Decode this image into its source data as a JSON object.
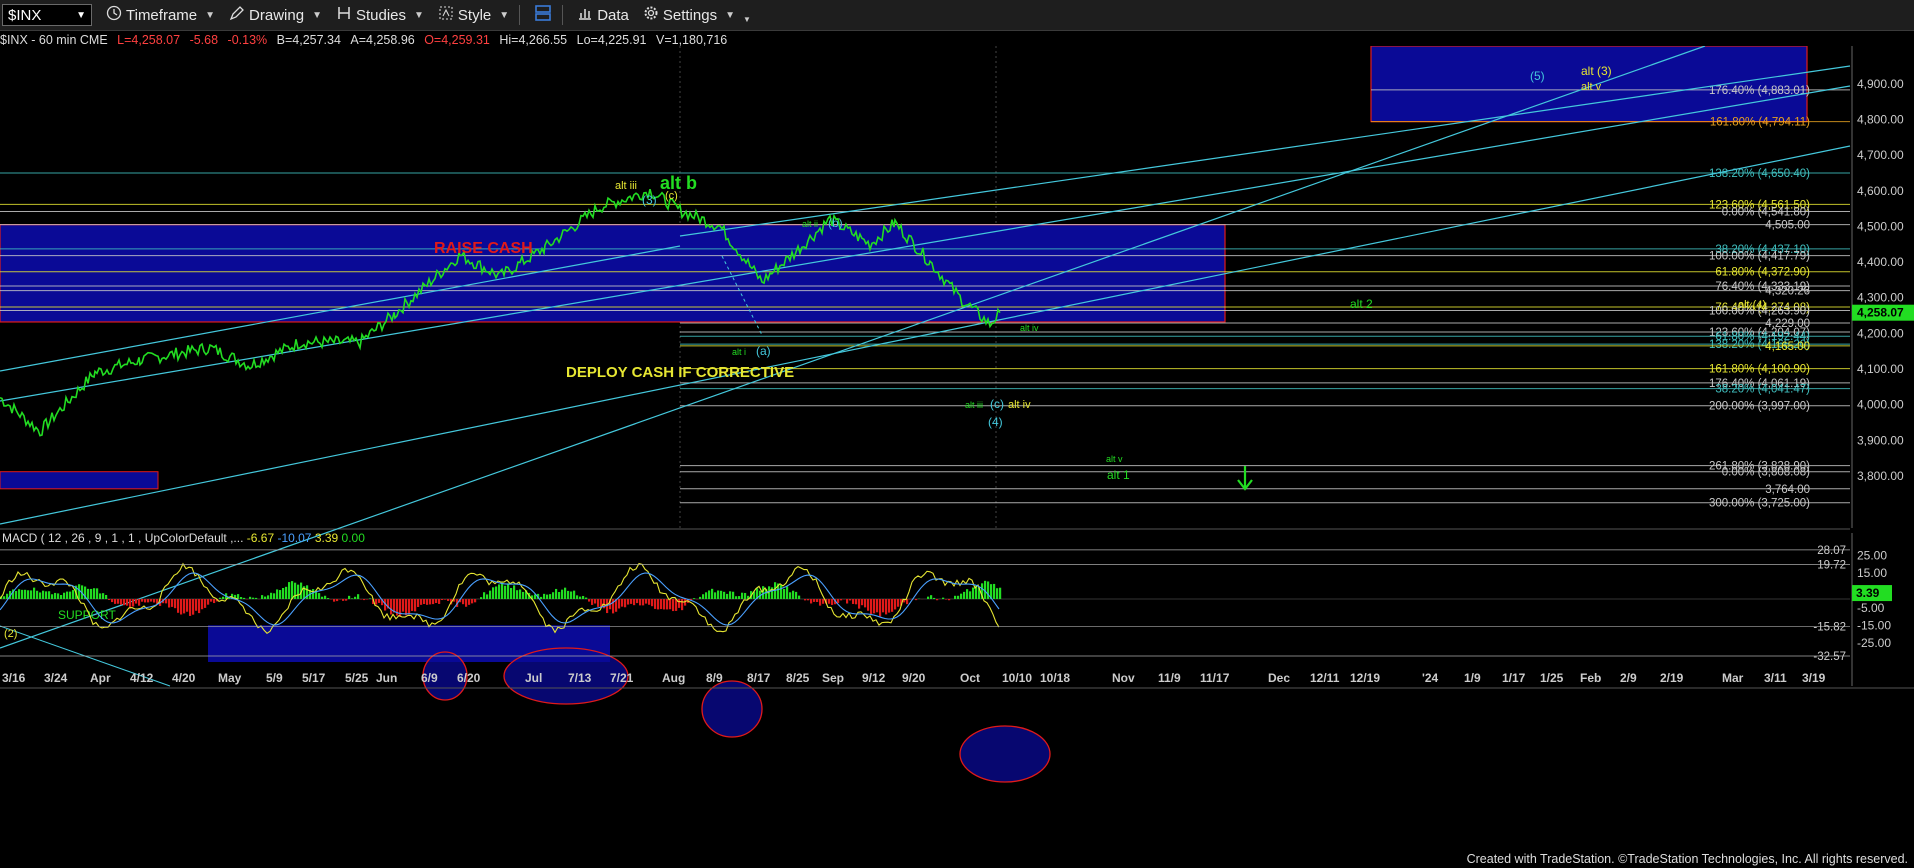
{
  "toolbar": {
    "symbol": "$INX",
    "items": [
      {
        "label": "Timeframe",
        "icon": "clock-icon"
      },
      {
        "label": "Drawing",
        "icon": "pencil-icon"
      },
      {
        "label": "Studies",
        "icon": "studies-icon"
      },
      {
        "label": "Style",
        "icon": "style-icon"
      },
      {
        "label": "",
        "icon": "layout-icon"
      },
      {
        "label": "Data",
        "icon": "bar-chart-icon"
      },
      {
        "label": "Settings",
        "icon": "gear-icon"
      }
    ]
  },
  "info_line": {
    "symbol": "$INX - 60 min CME",
    "last": "L=4,258.07",
    "chg": "-5.68",
    "pct": "-0.13%",
    "bid": "B=4,257.34",
    "ask": "A=4,258.96",
    "open": "O=4,259.31",
    "high": "Hi=4,266.55",
    "low": "Lo=4,225.91",
    "volume": "V=1,180,716"
  },
  "macd_header": {
    "name": "MACD ( 12 , 26 , 9 , 1 , 1 , UpColorDefault ,...",
    "v1": "-6.67",
    "v2": "-10.07",
    "v3": "3.39",
    "v4": "0.00"
  },
  "colors": {
    "price": "#22dd22",
    "channel": "#44c8dc",
    "blue_box": "#0a0a96",
    "fib": "#c8c8c8",
    "yellow": "#e6e632",
    "red": "#e01a1a"
  },
  "price_axis": {
    "ticks": [
      {
        "label": "4,900.00",
        "v": 4900
      },
      {
        "label": "4,800.00",
        "v": 4800
      },
      {
        "label": "4,700.00",
        "v": 4700
      },
      {
        "label": "4,600.00",
        "v": 4600
      },
      {
        "label": "4,500.00",
        "v": 4500
      },
      {
        "label": "4,400.00",
        "v": 4400
      },
      {
        "label": "4,300.00",
        "v": 4300
      },
      {
        "label": "4,200.00",
        "v": 4200
      },
      {
        "label": "4,100.00",
        "v": 4100
      },
      {
        "label": "4,000.00",
        "v": 4000
      },
      {
        "label": "3,900.00",
        "v": 3900
      },
      {
        "label": "3,800.00",
        "v": 3800
      }
    ],
    "last_price": "4,258.07"
  },
  "levels": [
    {
      "label": "176.40% (4,883.01)",
      "v": 4883,
      "color": "#c8c8c8"
    },
    {
      "label": "161.80% (4,794.11)",
      "v": 4794,
      "color": "#e6a020"
    },
    {
      "label": "138.20% (4,650.40)",
      "v": 4650,
      "color": "#40c0c0"
    },
    {
      "label": "123.60% (4,561.50)",
      "v": 4562,
      "color": "#e6e632"
    },
    {
      "label": "0.00% (4,541.80)",
      "v": 4542,
      "color": "#c8c8c8"
    },
    {
      "label": "4,505.00",
      "v": 4505,
      "color": "#c8c8c8"
    },
    {
      "label": "38.20% (4,437.10)",
      "v": 4437,
      "color": "#40c0c0"
    },
    {
      "label": "100.00% (4,417.79)",
      "v": 4418,
      "color": "#c8c8c8"
    },
    {
      "label": "61.80% (4,372.90)",
      "v": 4373,
      "color": "#e6e632"
    },
    {
      "label": "76.40% (4,333.19)",
      "v": 4333,
      "color": "#c8c8c8"
    },
    {
      "label": "4,320.26",
      "v": 4320,
      "color": "#c8c8c8"
    },
    {
      "label": "76.40% (4,274.08)",
      "v": 4274,
      "color": "#e6e632"
    },
    {
      "label": "100.00% (4,263.90)",
      "v": 4264,
      "color": "#c8c8c8"
    },
    {
      "label": "4,229.00",
      "v": 4229,
      "color": "#c8c8c8"
    },
    {
      "label": "123.60% (4,204.07)",
      "v": 4204,
      "color": "#c8c8c8"
    },
    {
      "label": "61.80% (4,192.44)",
      "v": 4192,
      "color": "#40c0c0"
    },
    {
      "label": "138.20% (4,165.20)",
      "v": 4170,
      "color": "#40c0c0"
    },
    {
      "label": "4,165.00",
      "v": 4165,
      "color": "#e6e632"
    },
    {
      "label": "161.80% (4,100.90)",
      "v": 4101,
      "color": "#e6e632"
    },
    {
      "label": "176.40% (4,061.19)",
      "v": 4061,
      "color": "#c8c8c8"
    },
    {
      "label": "38.20% (4,041.47)",
      "v": 4045,
      "color": "#40c0c0"
    },
    {
      "label": "200.00% (3,997.00)",
      "v": 3997,
      "color": "#c8c8c8"
    },
    {
      "label": "261.80% (3,828.90)",
      "v": 3829,
      "color": "#c8c8c8"
    },
    {
      "label": "0.00% (3,808.08)",
      "v": 3812,
      "color": "#c8c8c8"
    },
    {
      "label": "3,764.00",
      "v": 3764,
      "color": "#c8c8c8"
    },
    {
      "label": "300.00% (3,725.00)",
      "v": 3725,
      "color": "#c8c8c8"
    }
  ],
  "annotations": [
    {
      "text": "RAISE CASH",
      "color": "#e01a1a",
      "size": 16,
      "bold": true
    },
    {
      "text": "DEPLOY CASH IF CORRECTIVE",
      "color": "#e6e632",
      "size": 15,
      "bold": true
    },
    {
      "text": "SUPPORT",
      "color": "#22dd22",
      "size": 12,
      "bold": false
    },
    {
      "text": "alt b",
      "color": "#22dd22",
      "size": 18,
      "bold": true
    },
    {
      "text": "alt iii",
      "color": "#e6e632",
      "size": 11,
      "bold": false
    },
    {
      "text": "(3)",
      "color": "#44c8dc",
      "size": 12,
      "bold": false
    },
    {
      "text": "(c)",
      "color": "#e6e632",
      "size": 11,
      "bold": false
    },
    {
      "text": "alt ii",
      "color": "#22dd22",
      "size": 9,
      "bold": false
    },
    {
      "text": "(b)",
      "color": "#44c8dc",
      "size": 12,
      "bold": false
    },
    {
      "text": "alt i",
      "color": "#22dd22",
      "size": 9,
      "bold": false
    },
    {
      "text": "(a)",
      "color": "#44c8dc",
      "size": 12,
      "bold": false
    },
    {
      "text": "alt iv",
      "color": "#22dd22",
      "size": 9,
      "bold": false
    },
    {
      "text": "alt iii",
      "color": "#22dd22",
      "size": 9,
      "bold": false
    },
    {
      "text": "(c)",
      "color": "#44c8dc",
      "size": 12,
      "bold": false
    },
    {
      "text": "alt iv",
      "color": "#e6e632",
      "size": 11,
      "bold": false
    },
    {
      "text": "(4)",
      "color": "#44c8dc",
      "size": 12,
      "bold": false
    },
    {
      "text": "alt 2",
      "color": "#22dd22",
      "size": 12,
      "bold": false
    },
    {
      "text": "alt (4)",
      "color": "#e6e632",
      "size": 11,
      "bold": false
    },
    {
      "text": "alt v",
      "color": "#22dd22",
      "size": 9,
      "bold": false
    },
    {
      "text": "alt 1",
      "color": "#22dd22",
      "size": 12,
      "bold": false
    },
    {
      "text": "(5)",
      "color": "#44c8dc",
      "size": 12,
      "bold": false
    },
    {
      "text": "alt (3)",
      "color": "#e6e632",
      "size": 12,
      "bold": false
    },
    {
      "text": "alt v",
      "color": "#e6e632",
      "size": 11,
      "bold": false
    },
    {
      "text": "(2)",
      "color": "#e6e632",
      "size": 11,
      "bold": false
    }
  ],
  "macd_axis": {
    "ticks": [
      {
        "label": "25.00",
        "v": 25
      },
      {
        "label": "15.00",
        "v": 15
      },
      {
        "label": "-5.00",
        "v": -5
      },
      {
        "label": "-15.00",
        "v": -15
      },
      {
        "label": "-25.00",
        "v": -25
      }
    ],
    "levels": [
      {
        "label": "19.72",
        "v": 19.72
      },
      {
        "label": "-15.82",
        "v": -15.82
      },
      {
        "label": "-32.57",
        "v": -32.57
      },
      {
        "label": "28.07",
        "v": 28.07
      }
    ],
    "current": "3.39"
  },
  "time_axis": [
    "3/16",
    "3/24",
    "Apr",
    "4/12",
    "4/20",
    "May",
    "5/9",
    "5/17",
    "5/25",
    "Jun",
    "6/9",
    "6/20",
    "Jul",
    "7/13",
    "7/21",
    "Aug",
    "8/9",
    "8/17",
    "8/25",
    "Sep",
    "9/12",
    "9/20",
    "Oct",
    "10/10",
    "10/18",
    "Nov",
    "11/9",
    "11/17",
    "Dec",
    "12/11",
    "12/19",
    "'24",
    "1/9",
    "1/17",
    "1/25",
    "Feb",
    "2/9",
    "2/19",
    "Mar",
    "3/11",
    "3/19"
  ],
  "footer": "Created with TradeStation. ©TradeStation Technologies, Inc. All rights reserved."
}
